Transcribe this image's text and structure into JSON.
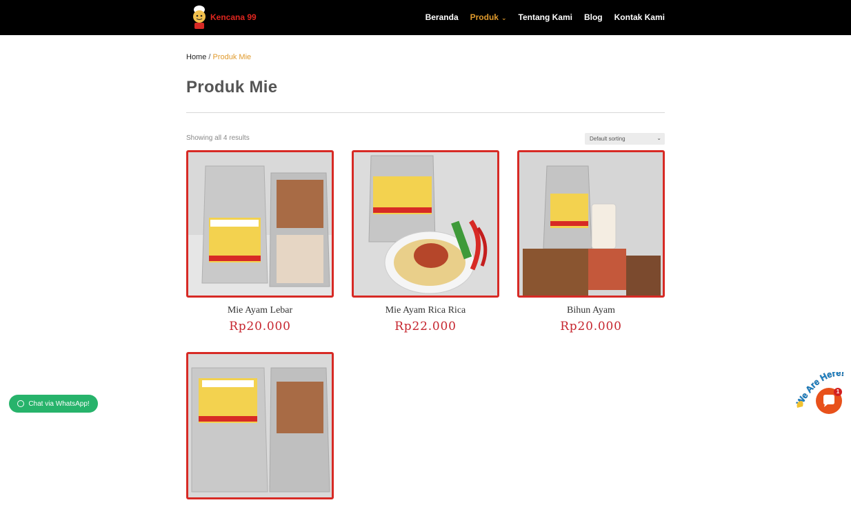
{
  "header": {
    "logo_text": "Kencana 99",
    "nav": [
      {
        "label": "Beranda"
      },
      {
        "label": "Produk",
        "active": true
      },
      {
        "label": "Tentang Kami"
      },
      {
        "label": "Blog"
      },
      {
        "label": "Kontak Kami"
      }
    ]
  },
  "breadcrumb": {
    "home": "Home",
    "separator": " / ",
    "current": "Produk Mie"
  },
  "page": {
    "title": "Produk Mie",
    "results_text": "Showing all 4 results",
    "sort_selected": "Default sorting"
  },
  "products": [
    {
      "name": "Mie Ayam Lebar",
      "price": "Rp20.000"
    },
    {
      "name": "Mie Ayam Rica Rica",
      "price": "Rp22.000"
    },
    {
      "name": "Bihun Ayam",
      "price": "Rp20.000"
    },
    {
      "name": "",
      "price": ""
    }
  ],
  "whatsapp": {
    "label": "Chat via WhatsApp!"
  },
  "chat": {
    "badge": "1",
    "tagline": "We Are Here!"
  },
  "colors": {
    "header_bg": "#000000",
    "accent": "#e09a2c",
    "price": "#c6252e",
    "card_border": "#d72a25",
    "whatsapp": "#27b36b",
    "chat": "#e8511b"
  }
}
